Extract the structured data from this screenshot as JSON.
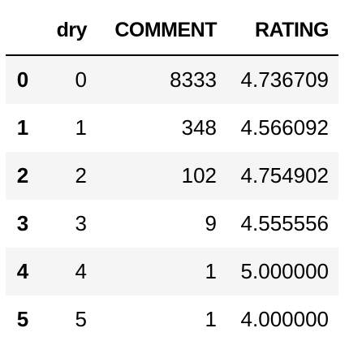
{
  "table": {
    "index_header": "",
    "columns": [
      "dry",
      "COMMENT",
      "RATING"
    ],
    "rows": [
      {
        "index": "0",
        "dry": "0",
        "comment": "8333",
        "rating": "4.736709"
      },
      {
        "index": "1",
        "dry": "1",
        "comment": "348",
        "rating": "4.566092"
      },
      {
        "index": "2",
        "dry": "2",
        "comment": "102",
        "rating": "4.754902"
      },
      {
        "index": "3",
        "dry": "3",
        "comment": "9",
        "rating": "4.555556"
      },
      {
        "index": "4",
        "dry": "4",
        "comment": "1",
        "rating": "5.000000"
      },
      {
        "index": "5",
        "dry": "5",
        "comment": "1",
        "rating": "4.000000"
      }
    ],
    "row_stripe_color": "#f5f5f5",
    "header_rule_color": "#000000"
  }
}
